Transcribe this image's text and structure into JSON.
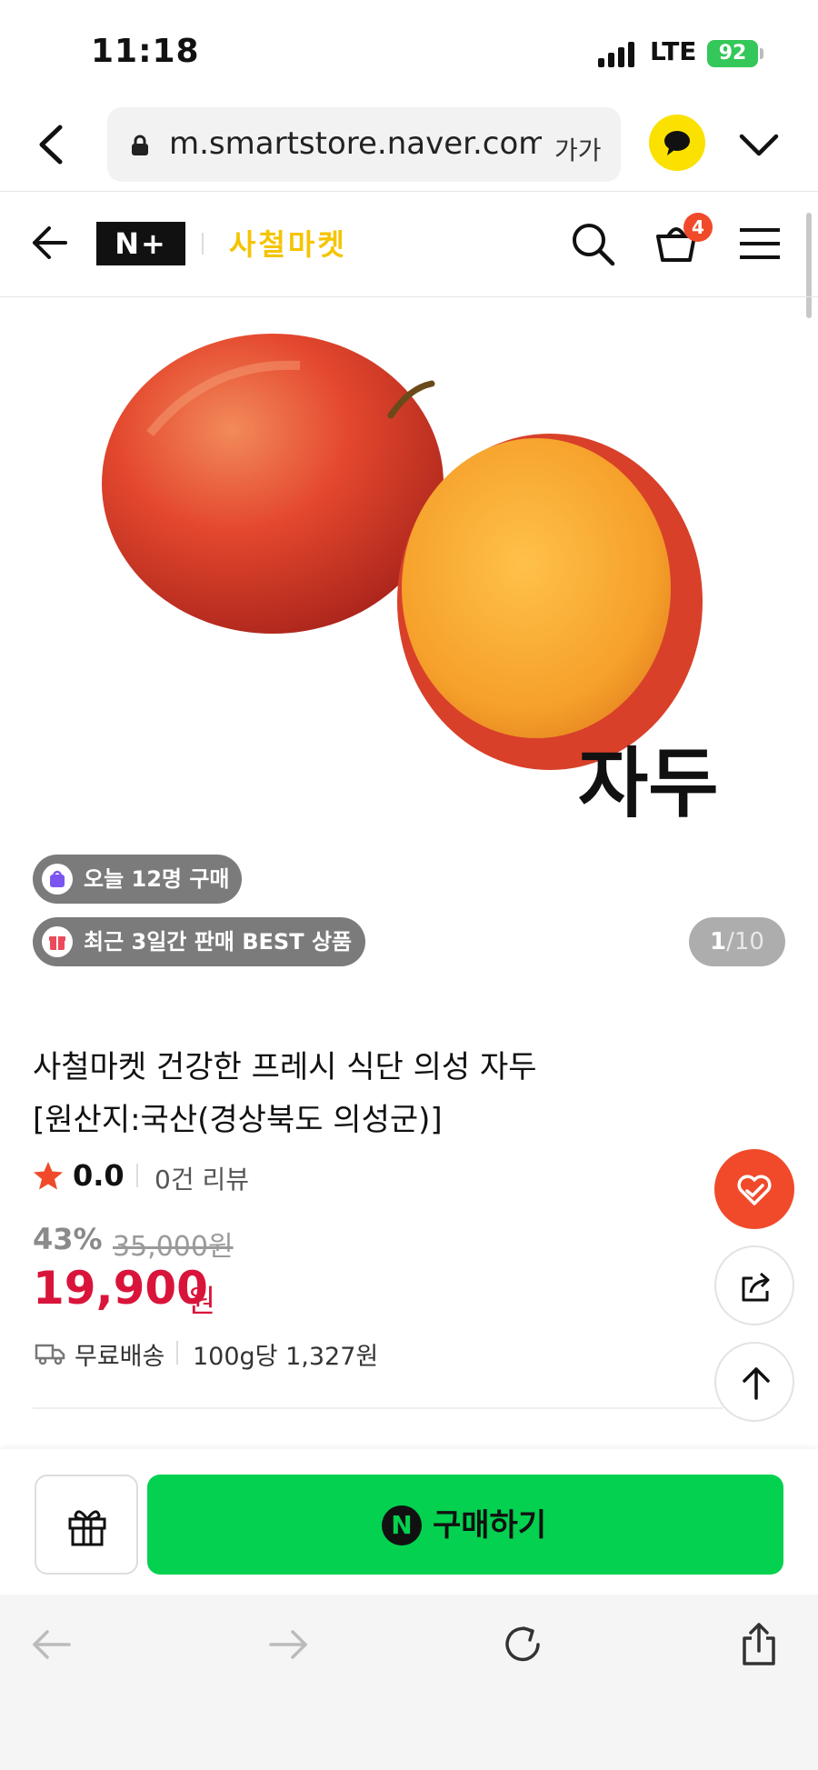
{
  "status_bar": {
    "time": "11:18",
    "network": "LTE",
    "battery": "92"
  },
  "browser": {
    "url": "m.smartstore.naver.com",
    "text_size": "가가"
  },
  "store": {
    "logo": "N+",
    "name": "사철마켓",
    "cart_count": "4"
  },
  "product_image": {
    "label": "자두"
  },
  "badges": [
    {
      "text": "오늘 12명 구매",
      "icon": "shopping-bag-icon"
    },
    {
      "text": "최근 3일간 판매 BEST 상품",
      "icon": "gift-box-icon"
    }
  ],
  "image_counter": {
    "current": "1",
    "total": "/10"
  },
  "product": {
    "title_line1": "사철마켓 건강한 프레시 식단 의성 자두",
    "title_line2": "[원산지:국산(경상북도 의성군)]",
    "rating": "0.0",
    "reviews": "0건 리뷰",
    "discount": "43%",
    "original_price": "35,000원",
    "price": "19,900",
    "currency": "원",
    "shipping": "무료배송",
    "unit_price": "100g당 1,327원"
  },
  "purchase": {
    "buy_label": "구매하기",
    "naver_pay": "N"
  },
  "colors": {
    "primary_green": "#03d14f",
    "price_red": "#d9143a",
    "accent_orange": "#f04a2a",
    "store_yellow": "#f5c400"
  }
}
